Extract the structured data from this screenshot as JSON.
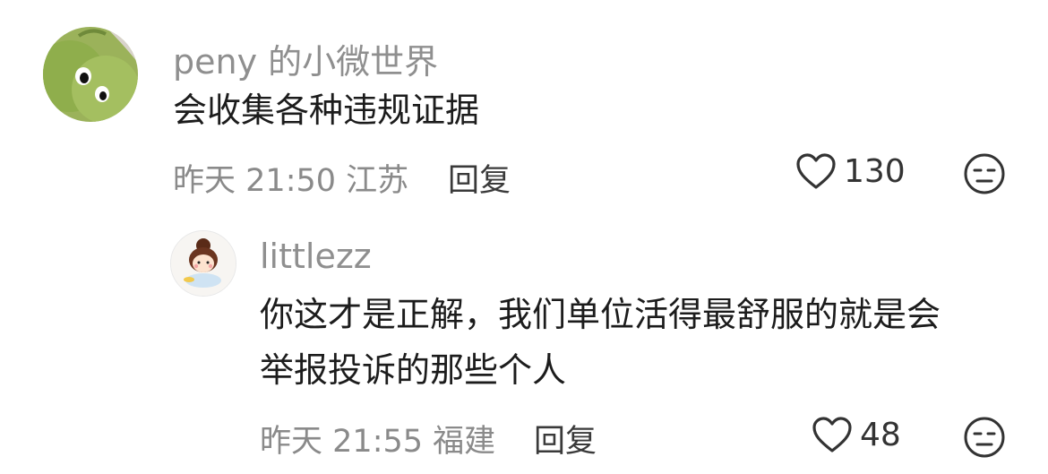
{
  "comments": [
    {
      "username": "peny 的小微世界",
      "content": "会收集各种违规证据",
      "date": "昨天",
      "time": "21:50",
      "location": "江苏",
      "reply_label": "回复",
      "likes": "130"
    },
    {
      "username": "littlezz",
      "content_line1": "你这才是正解，我们单位活得最舒服的就是会",
      "content_line2": "举报投诉的那些个人",
      "date": "昨天",
      "time": "21:55",
      "location": "福建",
      "reply_label": "回复",
      "likes": "48"
    }
  ],
  "icons": {
    "like": "heart-icon",
    "dislike": "meh-face-icon"
  },
  "colors": {
    "muted": "#8a8a8a",
    "text": "#1c1c1c",
    "icon": "#333333"
  }
}
